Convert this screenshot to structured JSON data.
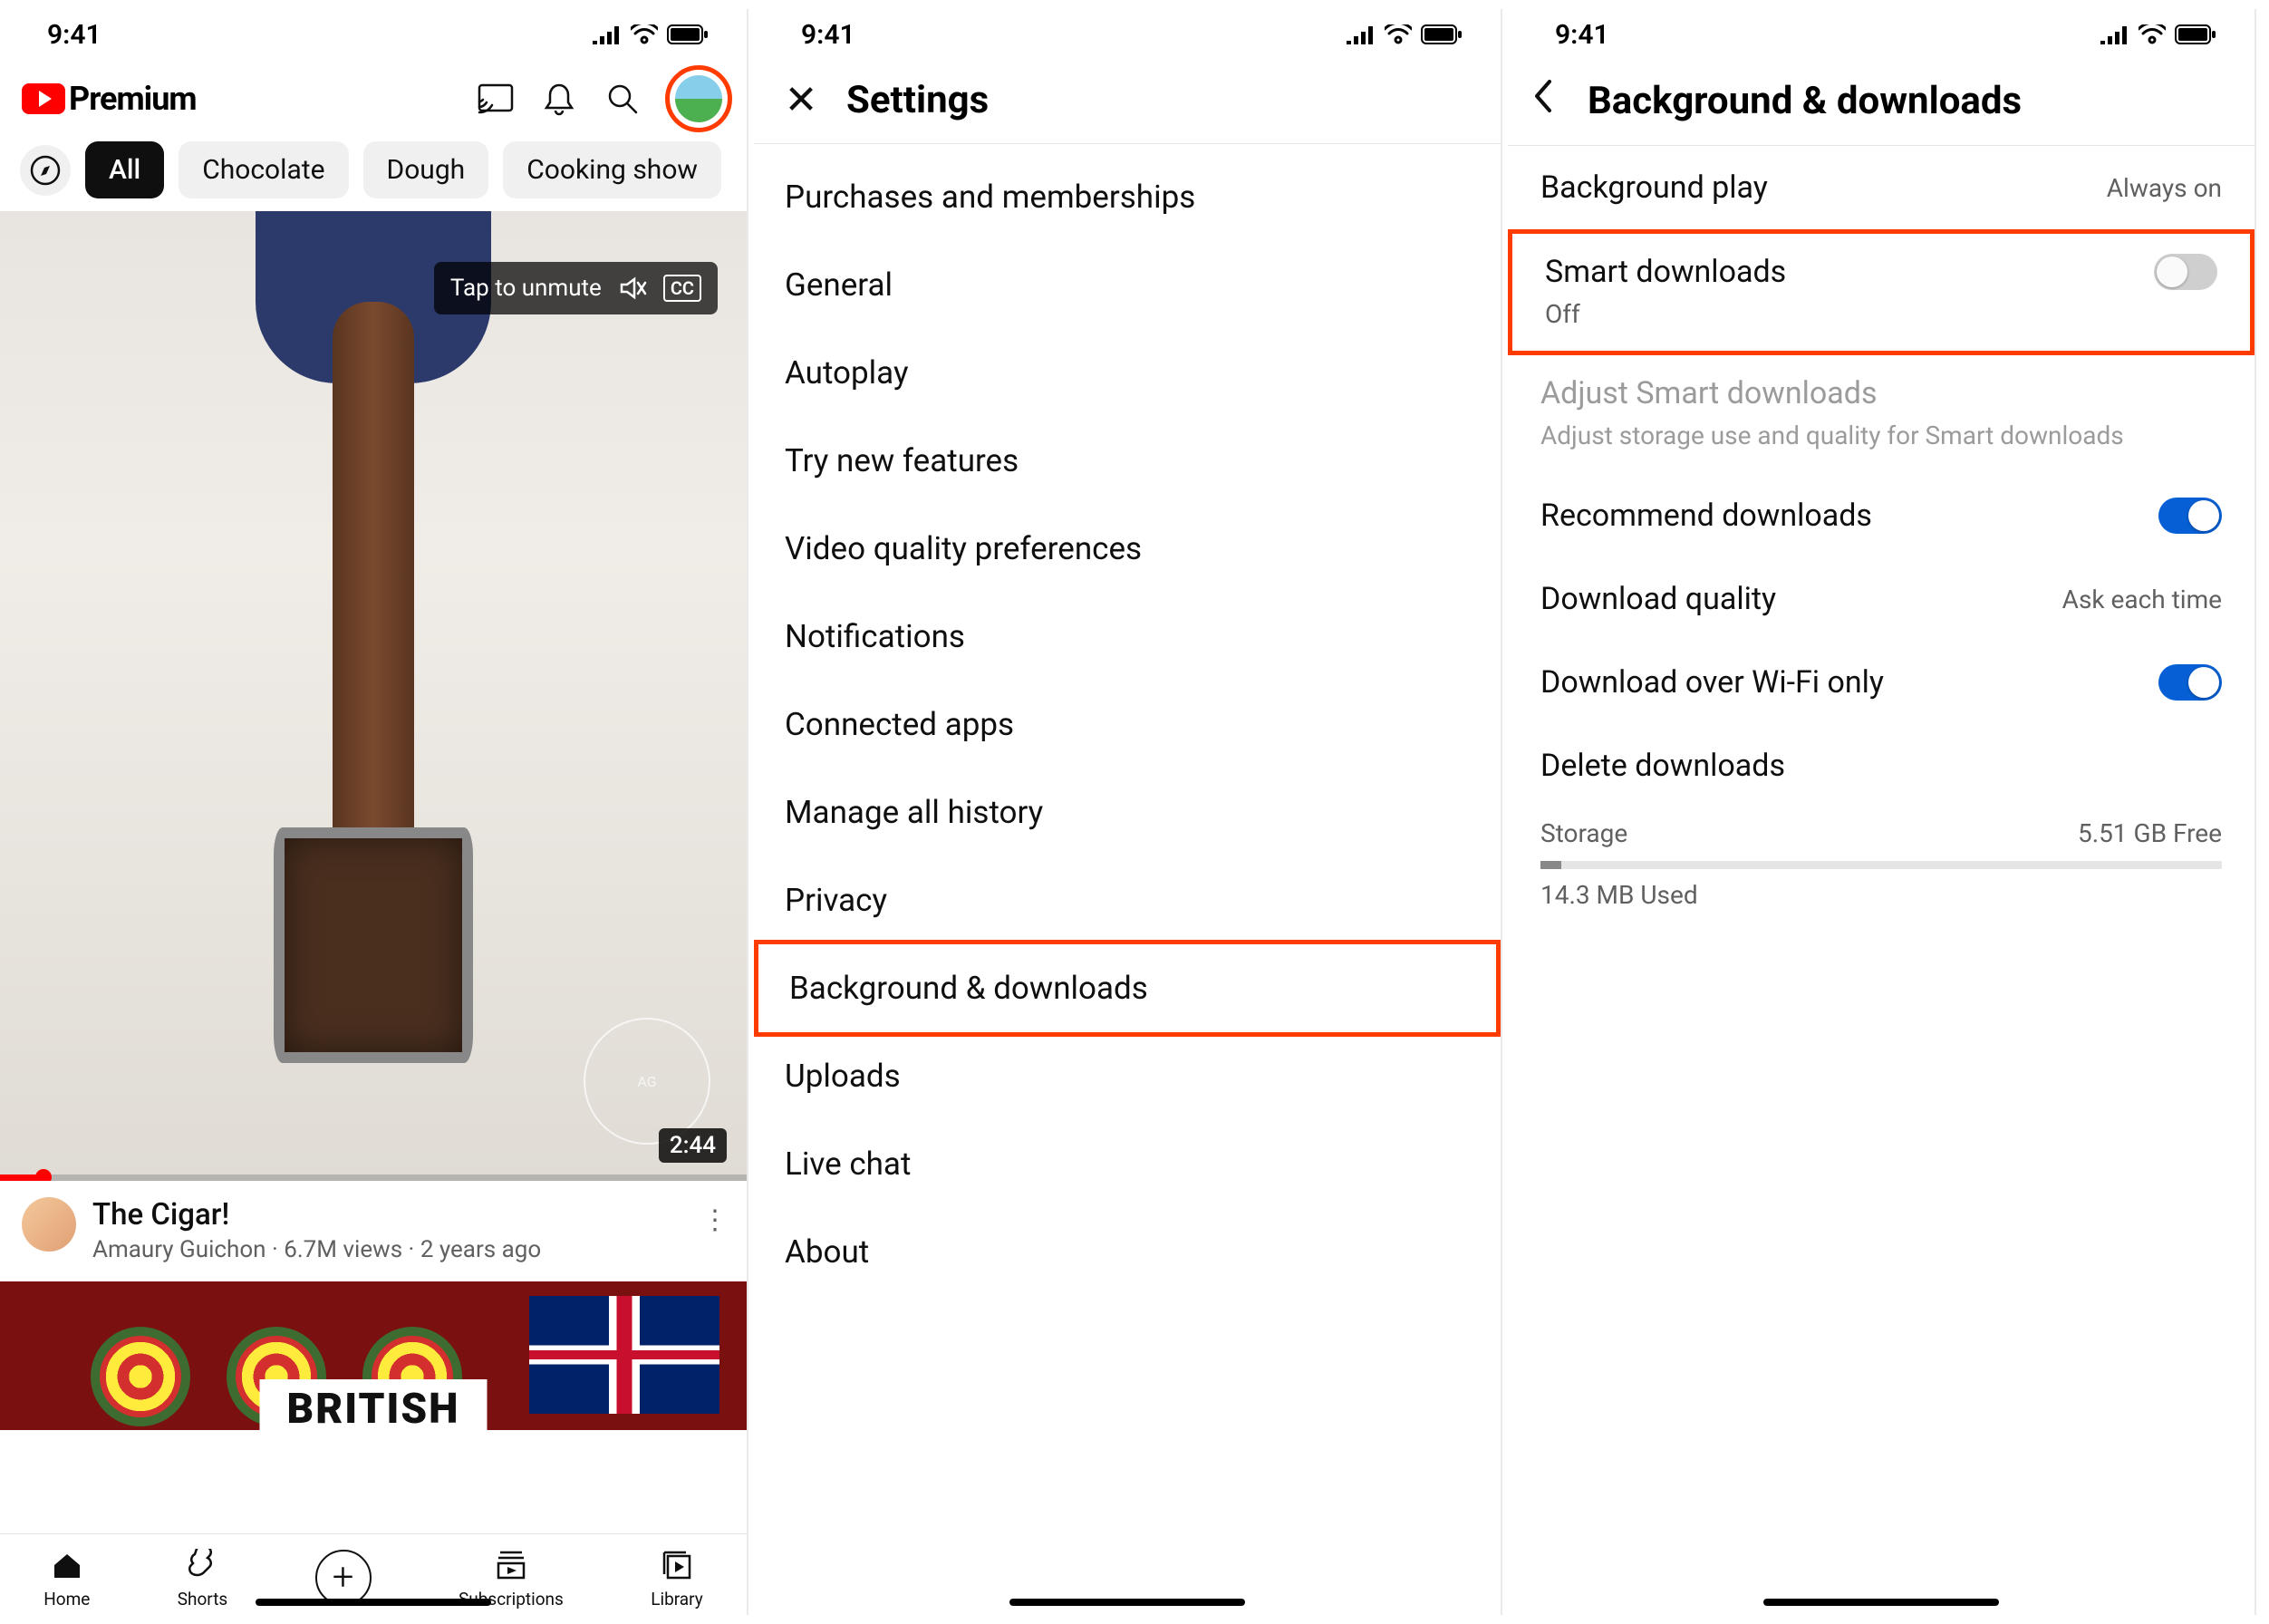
{
  "status": {
    "time": "9:41"
  },
  "phone1": {
    "brand": "Premium",
    "chips": [
      "All",
      "Chocolate",
      "Dough",
      "Cooking show"
    ],
    "tap_unmute": "Tap to unmute",
    "cc": "CC",
    "duration": "2:44",
    "video1": {
      "title": "The Cigar!",
      "channel": "Amaury Guichon",
      "views": "6.7M views",
      "age": "2 years ago"
    },
    "video2_text": "BRITISH",
    "nav": [
      "Home",
      "Shorts",
      "",
      "Subscriptions",
      "Library"
    ]
  },
  "phone2": {
    "title": "Settings",
    "items": [
      "Purchases and memberships",
      "General",
      "Autoplay",
      "Try new features",
      "Video quality preferences",
      "Notifications",
      "Connected apps",
      "Manage all history",
      "Privacy",
      "Background & downloads",
      "Uploads",
      "Live chat",
      "About"
    ]
  },
  "phone3": {
    "title": "Background & downloads",
    "background_play": {
      "label": "Background play",
      "value": "Always on"
    },
    "smart_downloads": {
      "label": "Smart downloads",
      "sub": "Off"
    },
    "adjust": {
      "label": "Adjust Smart downloads",
      "sub": "Adjust storage use and quality for Smart downloads"
    },
    "recommend": {
      "label": "Recommend downloads"
    },
    "download_quality": {
      "label": "Download quality",
      "value": "Ask each time"
    },
    "wifi_only": {
      "label": "Download over Wi-Fi only"
    },
    "delete": {
      "label": "Delete downloads"
    },
    "storage": {
      "label": "Storage",
      "free": "5.51 GB Free",
      "used": "14.3 MB Used"
    }
  }
}
